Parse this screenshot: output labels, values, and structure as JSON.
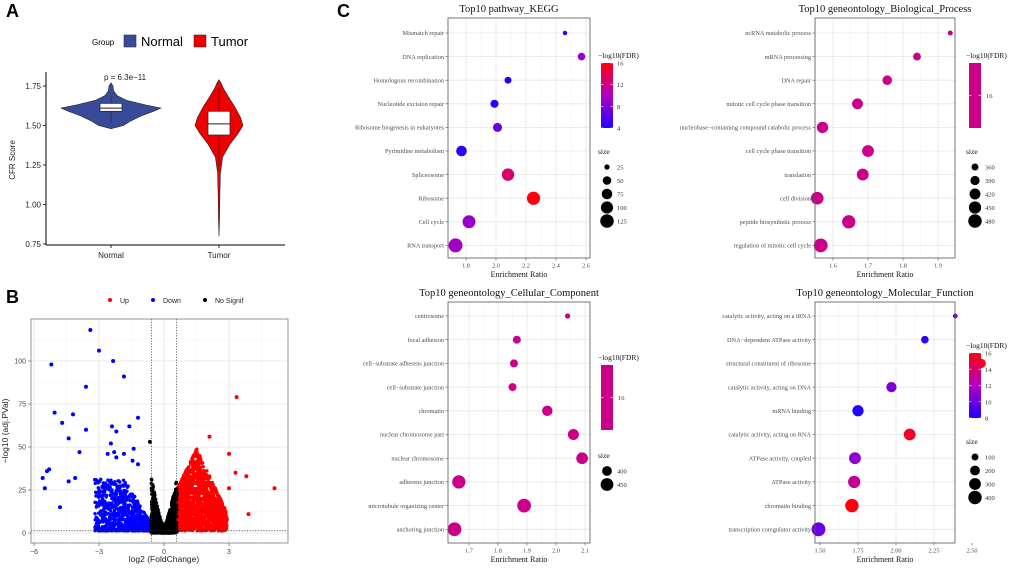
{
  "panels": {
    "A": "A",
    "B": "B",
    "C": "C"
  },
  "chart_data": [
    {
      "id": "violin",
      "type": "violin",
      "panel": "A",
      "legend": {
        "title": "Group",
        "position": "top",
        "entries": [
          {
            "name": "Normal",
            "color": "#3a4a9a"
          },
          {
            "name": "Tumor",
            "color": "#ee0000"
          }
        ]
      },
      "ylabel": "CFR Score",
      "xlabel": "",
      "categories": [
        "Normal",
        "Tumor"
      ],
      "ylim": [
        0.75,
        1.8
      ],
      "yticks": [
        0.75,
        1.0,
        1.25,
        1.5,
        1.75
      ],
      "ytick_labels": [
        "0.75",
        "1.00",
        "1.25",
        "1.50",
        "1.75"
      ],
      "annotation": "p = 6.3e−11",
      "groups": [
        {
          "name": "Normal",
          "color": "#3a4a9a",
          "min": 1.48,
          "q1": 1.59,
          "median": 1.61,
          "q3": 1.64,
          "max": 1.77,
          "whisker_low": 1.51,
          "whisker_high": 1.69,
          "density": [
            [
              1.48,
              0.0
            ],
            [
              1.5,
              0.25
            ],
            [
              1.53,
              0.4
            ],
            [
              1.56,
              0.6
            ],
            [
              1.59,
              0.85
            ],
            [
              1.61,
              1.0
            ],
            [
              1.63,
              0.7
            ],
            [
              1.66,
              0.3
            ],
            [
              1.69,
              0.12
            ],
            [
              1.72,
              0.05
            ],
            [
              1.75,
              0.04
            ],
            [
              1.77,
              0.0
            ]
          ]
        },
        {
          "name": "Tumor",
          "color": "#ee0000",
          "min": 0.8,
          "q1": 1.44,
          "median": 1.51,
          "q3": 1.59,
          "max": 1.79,
          "whisker_low": 1.22,
          "whisker_high": 1.75,
          "density": [
            [
              0.8,
              0.0
            ],
            [
              0.9,
              0.02
            ],
            [
              1.0,
              0.03
            ],
            [
              1.1,
              0.04
            ],
            [
              1.2,
              0.06
            ],
            [
              1.3,
              0.15
            ],
            [
              1.38,
              0.45
            ],
            [
              1.45,
              0.8
            ],
            [
              1.5,
              1.0
            ],
            [
              1.55,
              0.9
            ],
            [
              1.62,
              0.65
            ],
            [
              1.68,
              0.4
            ],
            [
              1.73,
              0.2
            ],
            [
              1.77,
              0.08
            ],
            [
              1.79,
              0.0
            ]
          ]
        }
      ]
    },
    {
      "id": "volcano",
      "type": "scatter",
      "panel": "B",
      "legend": {
        "position": "top",
        "entries": [
          {
            "name": "Up",
            "color": "#ff0000"
          },
          {
            "name": "Down",
            "color": "#0000ff"
          },
          {
            "name": "No Signif",
            "color": "#000000"
          }
        ]
      },
      "xlabel": "log2 (FoldChange)",
      "ylabel": "−log10 (adj.PVal)",
      "xlim": [
        -6.1,
        5.6
      ],
      "ylim": [
        -5,
        125
      ],
      "xticks": [
        -6,
        -3,
        0,
        3
      ],
      "xtick_labels": [
        "−6",
        "−3",
        "0",
        "3"
      ],
      "yticks": [
        0,
        25,
        50,
        75,
        100
      ],
      "ytick_labels": [
        "0",
        "25",
        "50",
        "75",
        "100"
      ],
      "thresholds": {
        "log2fc": [
          -0.58,
          0.58
        ],
        "neglog10p": 1.3
      },
      "highlight_points": [
        {
          "x": -3.4,
          "y": 118,
          "group": "Down"
        },
        {
          "x": -3.0,
          "y": 106,
          "group": "Down"
        },
        {
          "x": -2.35,
          "y": 100,
          "group": "Down"
        },
        {
          "x": -5.2,
          "y": 98,
          "group": "Down"
        },
        {
          "x": -1.85,
          "y": 91,
          "group": "Down"
        },
        {
          "x": -3.6,
          "y": 85,
          "group": "Down"
        },
        {
          "x": -5.05,
          "y": 70,
          "group": "Down"
        },
        {
          "x": -4.2,
          "y": 69,
          "group": "Down"
        },
        {
          "x": -1.2,
          "y": 67,
          "group": "Down"
        },
        {
          "x": -4.7,
          "y": 64,
          "group": "Down"
        },
        {
          "x": -2.4,
          "y": 62,
          "group": "Down"
        },
        {
          "x": -1.6,
          "y": 62,
          "group": "Down"
        },
        {
          "x": -3.6,
          "y": 60,
          "group": "Down"
        },
        {
          "x": -2.2,
          "y": 59,
          "group": "Down"
        },
        {
          "x": -4.4,
          "y": 55,
          "group": "Down"
        },
        {
          "x": -2.45,
          "y": 52,
          "group": "Down"
        },
        {
          "x": -1.4,
          "y": 49,
          "group": "Down"
        },
        {
          "x": -3.9,
          "y": 47,
          "group": "Down"
        },
        {
          "x": -2.3,
          "y": 47,
          "group": "Down"
        },
        {
          "x": -1.85,
          "y": 46,
          "group": "Down"
        },
        {
          "x": -2.6,
          "y": 46,
          "group": "Down"
        },
        {
          "x": -2.2,
          "y": 44,
          "group": "Down"
        },
        {
          "x": -1.45,
          "y": 42,
          "group": "Down"
        },
        {
          "x": -1.2,
          "y": 40,
          "group": "Down"
        },
        {
          "x": -5.4,
          "y": 36,
          "group": "Down"
        },
        {
          "x": -5.3,
          "y": 37,
          "group": "Down"
        },
        {
          "x": -5.6,
          "y": 32,
          "group": "Down"
        },
        {
          "x": -4.4,
          "y": 30,
          "group": "Down"
        },
        {
          "x": -4.1,
          "y": 32,
          "group": "Down"
        },
        {
          "x": -5.5,
          "y": 26,
          "group": "Down"
        },
        {
          "x": -4.8,
          "y": 15,
          "group": "Down"
        },
        {
          "x": -0.65,
          "y": 53,
          "group": "No Signif"
        },
        {
          "x": 3.35,
          "y": 79,
          "group": "Up"
        },
        {
          "x": 2.1,
          "y": 56,
          "group": "Up"
        },
        {
          "x": 5.1,
          "y": 26,
          "group": "Up"
        },
        {
          "x": 3.0,
          "y": 46,
          "group": "Up"
        },
        {
          "x": 3.8,
          "y": 33,
          "group": "Up"
        },
        {
          "x": 3.9,
          "y": 11,
          "group": "Up"
        },
        {
          "x": 3.3,
          "y": 35,
          "group": "Up"
        },
        {
          "x": 3.0,
          "y": 26,
          "group": "Up"
        },
        {
          "x": 2.9,
          "y": 8,
          "group": "Up"
        }
      ],
      "cloud_description": "dense clusters: Down (log2FC -3..-0.58, y 0..30), No Signif (|log2FC|<0.58, y 0..35), Up (log2FC 0.58..3, y 0..50)"
    },
    {
      "id": "kegg",
      "type": "scatter",
      "panel": "C",
      "title": "Top10 pathway_KEGG",
      "xlabel": "Enrichment Ratio",
      "xlim": [
        1.71,
        2.61
      ],
      "xticks": [
        1.8,
        2.0,
        2.2,
        2.4,
        2.6
      ],
      "xtick_labels": [
        "1.8",
        "2.0",
        "2.2",
        "2.4",
        "2.6"
      ],
      "categories": [
        "Mismatch repair",
        "DNA replication",
        "Homologous recombination",
        "Nucleotide excision repair",
        "Ribosome biogenesis in eukaryotes",
        "Pyrimidine metabolism",
        "Spliceosome",
        "Ribosome",
        "Cell cycle",
        "RNA transport"
      ],
      "x": [
        2.46,
        2.57,
        2.08,
        1.99,
        2.01,
        1.77,
        2.08,
        2.25,
        1.82,
        1.73
      ],
      "color_value": [
        5,
        9,
        4,
        4.5,
        7,
        4.5,
        13,
        16,
        9,
        9.5
      ],
      "size": [
        22,
        40,
        35,
        45,
        55,
        75,
        105,
        120,
        115,
        135
      ],
      "color_legend": {
        "title": "−log10(FDR)",
        "min": 4,
        "max": 16,
        "ticks": [
          4,
          8,
          12,
          16
        ],
        "tick_labels": [
          "4",
          "8",
          "12",
          "16"
        ],
        "low_color": "#0000ff",
        "high_color": "#ff0000"
      },
      "size_legend": {
        "title": "size",
        "values": [
          25,
          50,
          75,
          100,
          125
        ],
        "labels": [
          "25",
          "50",
          "75",
          "100",
          "125"
        ],
        "min": 20,
        "max": 135
      }
    },
    {
      "id": "bp",
      "type": "scatter",
      "panel": "C",
      "title": "Top10 geneontology_Biological_Process",
      "xlabel": "Enrichment Ratio",
      "xlim": [
        1.545,
        1.945
      ],
      "xticks": [
        1.6,
        1.7,
        1.8,
        1.9
      ],
      "xtick_labels": [
        "1.6",
        "1.7",
        "1.8",
        "1.9"
      ],
      "categories": [
        "ncRNA metabolic process",
        "mRNA processing",
        "DNA repair",
        "mitotic cell cycle phase transition",
        "nucleobase−containing compound catabolic process",
        "cell cycle phase transition",
        "translation",
        "cell division",
        "peptide biosynthetic process",
        "regulation of mitotic cell cycle"
      ],
      "x": [
        1.935,
        1.84,
        1.755,
        1.67,
        1.57,
        1.7,
        1.685,
        1.555,
        1.645,
        1.565
      ],
      "color_value": [
        16,
        16,
        16,
        16,
        16,
        16,
        16,
        16,
        16,
        16
      ],
      "size": [
        345,
        370,
        395,
        420,
        430,
        440,
        440,
        460,
        475,
        490
      ],
      "color_legend": {
        "title": "−log10(FDR)",
        "ticks": [
          16
        ],
        "tick_labels": [
          "16"
        ],
        "single_color": "#cc0088"
      },
      "size_legend": {
        "title": "size",
        "values": [
          360,
          390,
          420,
          450,
          480
        ],
        "labels": [
          "360",
          "390",
          "420",
          "450",
          "480"
        ],
        "min": 340,
        "max": 495
      }
    },
    {
      "id": "cc",
      "type": "scatter",
      "panel": "C",
      "title": "Top10 geneontology_Cellular_Component",
      "xlabel": "Enrichment Ratio",
      "xlim": [
        1.635,
        2.11
      ],
      "xticks": [
        1.7,
        1.8,
        1.9,
        2.0,
        2.1
      ],
      "xtick_labels": [
        "1.7",
        "1.8",
        "1.9",
        "2.0",
        "2.1"
      ],
      "categories": [
        "centrosome",
        "focal adhesion",
        "cell−substrate adherens junction",
        "cell−substrate junction",
        "chromatin",
        "nuclear chromosome part",
        "nuclear chromosome",
        "adherens junction",
        "microtubule organizing center",
        "anchoring junction"
      ],
      "x": [
        2.04,
        1.865,
        1.855,
        1.85,
        1.97,
        2.06,
        2.09,
        1.665,
        1.89,
        1.65
      ],
      "color_value": [
        16,
        16,
        16,
        16,
        16,
        16,
        16,
        16,
        16,
        16
      ],
      "size": [
        360,
        380,
        380,
        380,
        410,
        420,
        430,
        460,
        470,
        470
      ],
      "color_legend": {
        "title": "−log10(FDR)",
        "ticks": [
          16
        ],
        "tick_labels": [
          "16"
        ],
        "single_color": "#cc0088"
      },
      "size_legend": {
        "title": "size",
        "values": [
          400,
          450
        ],
        "labels": [
          "400",
          "450"
        ],
        "min": 355,
        "max": 475
      }
    },
    {
      "id": "mf",
      "type": "scatter",
      "panel": "C",
      "title": "Top10 geneontology_Molecular_Function",
      "xlabel": "Enrichment Ratio",
      "xlim": [
        1.47,
        2.58
      ],
      "xticks": [
        1.5,
        1.75,
        2.0,
        2.25,
        2.5
      ],
      "xtick_labels": [
        "1.50",
        "1.75",
        "2.00",
        "2.25",
        "2.50"
      ],
      "categories": [
        "catalytic activity, acting on a tRNA",
        "DNA−dependent ATPase activity",
        "structural constituent of ribosome",
        "catalytic activity, acting on DNA",
        "mRNA binding",
        "catalytic activity, acting on RNA",
        "ATPase activity, coupled",
        "ATPase activity",
        "chromatin binding",
        "transcription coregulator activity"
      ],
      "x": [
        2.39,
        2.19,
        2.56,
        1.97,
        1.75,
        2.09,
        1.73,
        1.725,
        1.71,
        1.49
      ],
      "color_value": [
        10,
        8.3,
        16,
        10.5,
        8,
        15.5,
        11,
        13,
        16,
        10
      ],
      "size": [
        60,
        120,
        180,
        220,
        270,
        300,
        300,
        330,
        400,
        430
      ],
      "color_legend": {
        "title": "−log10(FDR)",
        "min": 8,
        "max": 16,
        "ticks": [
          8,
          10,
          12,
          14,
          16
        ],
        "tick_labels": [
          "8",
          "10",
          "12",
          "14",
          "16"
        ],
        "low_color": "#0000ff",
        "high_color": "#ff0000"
      },
      "size_legend": {
        "title": "size",
        "values": [
          100,
          200,
          300,
          400
        ],
        "labels": [
          "100",
          "200",
          "300",
          "400"
        ],
        "min": 50,
        "max": 440
      }
    }
  ]
}
